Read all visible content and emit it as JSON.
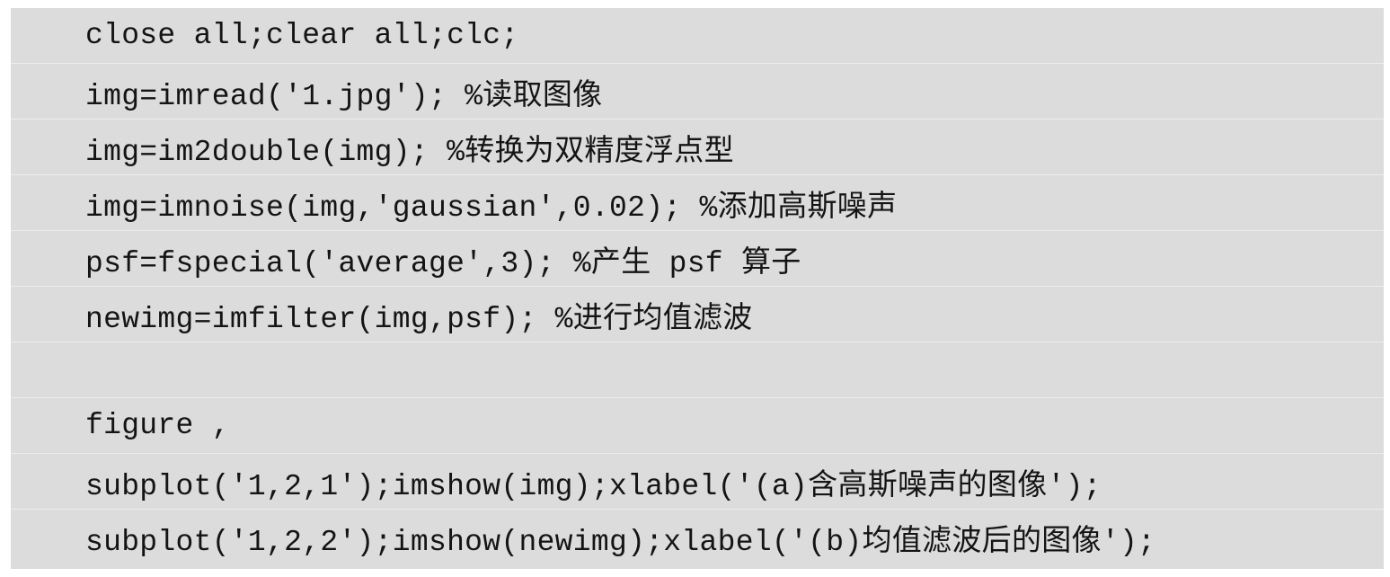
{
  "code": {
    "lines": [
      "close all;clear all;clc;",
      "img=imread('1.jpg'); %读取图像",
      "img=im2double(img); %转换为双精度浮点型",
      "img=imnoise(img,'gaussian',0.02); %添加高斯噪声",
      "psf=fspecial('average',3); %产生 psf 算子",
      "newimg=imfilter(img,psf); %进行均值滤波",
      "",
      "figure ,",
      "subplot('1,2,1');imshow(img);xlabel('(a)含高斯噪声的图像');",
      "subplot('1,2,2');imshow(newimg);xlabel('(b)均值滤波后的图像');"
    ]
  }
}
